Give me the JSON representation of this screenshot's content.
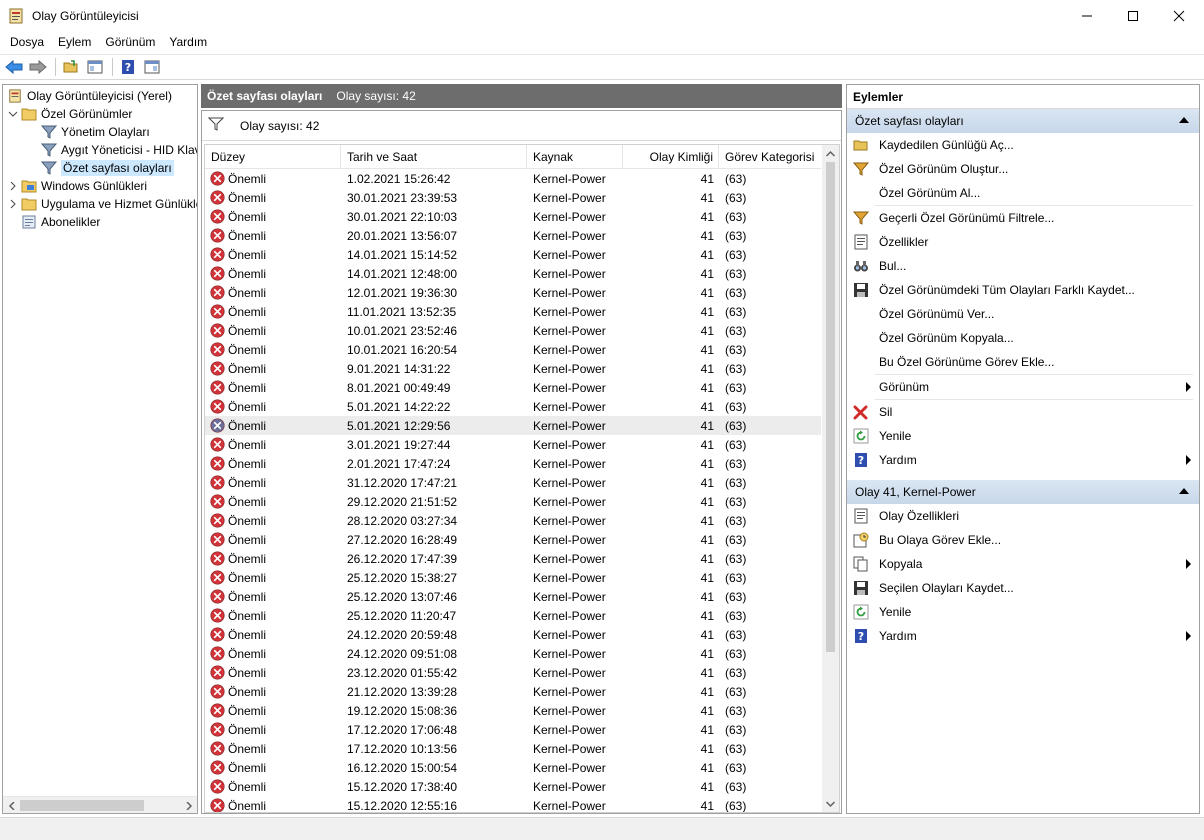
{
  "window": {
    "title": "Olay Görüntüleyicisi",
    "icon": "event-viewer-icon"
  },
  "menu": [
    "Dosya",
    "Eylem",
    "Görünüm",
    "Yardım"
  ],
  "toolbar": {
    "buttons": [
      "back-icon",
      "forward-icon",
      "open-folder-icon",
      "console-tree-icon",
      "help-icon",
      "action-pane-icon"
    ]
  },
  "tree": {
    "items": [
      {
        "label": "Olay Görüntüleyicisi (Yerel)",
        "icon": "event-viewer-icon"
      },
      {
        "label": "Özel Görünümler",
        "icon": "folder-icon"
      },
      {
        "label": "Yönetim Olayları",
        "icon": "filter-icon"
      },
      {
        "label": "Aygıt Yöneticisi - HID Klavye Aygıtı",
        "icon": "filter-icon"
      },
      {
        "label": "Özet sayfası olayları",
        "icon": "filter-icon"
      },
      {
        "label": "Windows Günlükleri",
        "icon": "folder-icon"
      },
      {
        "label": "Uygulama ve Hizmet Günlükleri",
        "icon": "folder-icon"
      },
      {
        "label": "Abonelikler",
        "icon": "subscriptions-icon"
      }
    ]
  },
  "center": {
    "header_title": "Özet sayfası olayları",
    "header_count": "Olay sayısı: 42",
    "filter_label": "Olay sayısı: 42",
    "columns": [
      "Düzey",
      "Tarih ve Saat",
      "Kaynak",
      "Olay Kimliği",
      "Görev Kategorisi"
    ],
    "rows": [
      {
        "level": "Önemli",
        "date": "1.02.2021 15:26:42",
        "source": "Kernel-Power",
        "id": "41",
        "category": "(63)"
      },
      {
        "level": "Önemli",
        "date": "30.01.2021 23:39:53",
        "source": "Kernel-Power",
        "id": "41",
        "category": "(63)"
      },
      {
        "level": "Önemli",
        "date": "30.01.2021 22:10:03",
        "source": "Kernel-Power",
        "id": "41",
        "category": "(63)"
      },
      {
        "level": "Önemli",
        "date": "20.01.2021 13:56:07",
        "source": "Kernel-Power",
        "id": "41",
        "category": "(63)"
      },
      {
        "level": "Önemli",
        "date": "14.01.2021 15:14:52",
        "source": "Kernel-Power",
        "id": "41",
        "category": "(63)"
      },
      {
        "level": "Önemli",
        "date": "14.01.2021 12:48:00",
        "source": "Kernel-Power",
        "id": "41",
        "category": "(63)"
      },
      {
        "level": "Önemli",
        "date": "12.01.2021 19:36:30",
        "source": "Kernel-Power",
        "id": "41",
        "category": "(63)"
      },
      {
        "level": "Önemli",
        "date": "11.01.2021 13:52:35",
        "source": "Kernel-Power",
        "id": "41",
        "category": "(63)"
      },
      {
        "level": "Önemli",
        "date": "10.01.2021 23:52:46",
        "source": "Kernel-Power",
        "id": "41",
        "category": "(63)"
      },
      {
        "level": "Önemli",
        "date": "10.01.2021 16:20:54",
        "source": "Kernel-Power",
        "id": "41",
        "category": "(63)"
      },
      {
        "level": "Önemli",
        "date": "9.01.2021 14:31:22",
        "source": "Kernel-Power",
        "id": "41",
        "category": "(63)"
      },
      {
        "level": "Önemli",
        "date": "8.01.2021 00:49:49",
        "source": "Kernel-Power",
        "id": "41",
        "category": "(63)"
      },
      {
        "level": "Önemli",
        "date": "5.01.2021 14:22:22",
        "source": "Kernel-Power",
        "id": "41",
        "category": "(63)"
      },
      {
        "level": "Önemli",
        "date": "5.01.2021 12:29:56",
        "source": "Kernel-Power",
        "id": "41",
        "category": "(63)",
        "selected": true
      },
      {
        "level": "Önemli",
        "date": "3.01.2021 19:27:44",
        "source": "Kernel-Power",
        "id": "41",
        "category": "(63)"
      },
      {
        "level": "Önemli",
        "date": "2.01.2021 17:47:24",
        "source": "Kernel-Power",
        "id": "41",
        "category": "(63)"
      },
      {
        "level": "Önemli",
        "date": "31.12.2020 17:47:21",
        "source": "Kernel-Power",
        "id": "41",
        "category": "(63)"
      },
      {
        "level": "Önemli",
        "date": "29.12.2020 21:51:52",
        "source": "Kernel-Power",
        "id": "41",
        "category": "(63)"
      },
      {
        "level": "Önemli",
        "date": "28.12.2020 03:27:34",
        "source": "Kernel-Power",
        "id": "41",
        "category": "(63)"
      },
      {
        "level": "Önemli",
        "date": "27.12.2020 16:28:49",
        "source": "Kernel-Power",
        "id": "41",
        "category": "(63)"
      },
      {
        "level": "Önemli",
        "date": "26.12.2020 17:47:39",
        "source": "Kernel-Power",
        "id": "41",
        "category": "(63)"
      },
      {
        "level": "Önemli",
        "date": "25.12.2020 15:38:27",
        "source": "Kernel-Power",
        "id": "41",
        "category": "(63)"
      },
      {
        "level": "Önemli",
        "date": "25.12.2020 13:07:46",
        "source": "Kernel-Power",
        "id": "41",
        "category": "(63)"
      },
      {
        "level": "Önemli",
        "date": "25.12.2020 11:20:47",
        "source": "Kernel-Power",
        "id": "41",
        "category": "(63)"
      },
      {
        "level": "Önemli",
        "date": "24.12.2020 20:59:48",
        "source": "Kernel-Power",
        "id": "41",
        "category": "(63)"
      },
      {
        "level": "Önemli",
        "date": "24.12.2020 09:51:08",
        "source": "Kernel-Power",
        "id": "41",
        "category": "(63)"
      },
      {
        "level": "Önemli",
        "date": "23.12.2020 01:55:42",
        "source": "Kernel-Power",
        "id": "41",
        "category": "(63)"
      },
      {
        "level": "Önemli",
        "date": "21.12.2020 13:39:28",
        "source": "Kernel-Power",
        "id": "41",
        "category": "(63)"
      },
      {
        "level": "Önemli",
        "date": "19.12.2020 15:08:36",
        "source": "Kernel-Power",
        "id": "41",
        "category": "(63)"
      },
      {
        "level": "Önemli",
        "date": "17.12.2020 17:06:48",
        "source": "Kernel-Power",
        "id": "41",
        "category": "(63)"
      },
      {
        "level": "Önemli",
        "date": "17.12.2020 10:13:56",
        "source": "Kernel-Power",
        "id": "41",
        "category": "(63)"
      },
      {
        "level": "Önemli",
        "date": "16.12.2020 15:00:54",
        "source": "Kernel-Power",
        "id": "41",
        "category": "(63)"
      },
      {
        "level": "Önemli",
        "date": "15.12.2020 17:38:40",
        "source": "Kernel-Power",
        "id": "41",
        "category": "(63)"
      },
      {
        "level": "Önemli",
        "date": "15.12.2020 12:55:16",
        "source": "Kernel-Power",
        "id": "41",
        "category": "(63)"
      }
    ]
  },
  "actions": {
    "title": "Eylemler",
    "sections": [
      {
        "title": "Özet sayfası olayları",
        "items": [
          {
            "label": "Kaydedilen Günlüğü Aç...",
            "icon": "open-folder-icon"
          },
          {
            "label": "Özel Görünüm Oluştur...",
            "icon": "filter-icon"
          },
          {
            "label": "Özel Görünüm Al...",
            "icon": ""
          },
          {
            "sep": true
          },
          {
            "label": "Geçerli Özel Görünümü Filtrele...",
            "icon": "filter-icon"
          },
          {
            "label": "Özellikler",
            "icon": "properties-icon"
          },
          {
            "label": "Bul...",
            "icon": "binoculars-icon"
          },
          {
            "label": "Özel Görünümdeki Tüm Olayları Farklı Kaydet...",
            "icon": "save-icon"
          },
          {
            "label": "Özel Görünümü Ver...",
            "icon": ""
          },
          {
            "label": "Özel Görünüm Kopyala...",
            "icon": ""
          },
          {
            "label": "Bu Özel Görünüme Görev Ekle...",
            "icon": ""
          },
          {
            "sep": true
          },
          {
            "label": "Görünüm",
            "icon": "",
            "submenu": true
          },
          {
            "sep": true
          },
          {
            "label": "Sil",
            "icon": "delete-icon"
          },
          {
            "label": "Yenile",
            "icon": "refresh-icon"
          },
          {
            "label": "Yardım",
            "icon": "help-icon",
            "submenu": true
          }
        ]
      },
      {
        "title": "Olay 41, Kernel-Power",
        "items": [
          {
            "label": "Olay Özellikleri",
            "icon": "properties-icon"
          },
          {
            "label": "Bu Olaya Görev Ekle...",
            "icon": "task-icon"
          },
          {
            "label": "Kopyala",
            "icon": "copy-icon",
            "submenu": true
          },
          {
            "label": "Seçilen Olayları Kaydet...",
            "icon": "save-icon"
          },
          {
            "label": "Yenile",
            "icon": "refresh-icon"
          },
          {
            "label": "Yardım",
            "icon": "help-icon",
            "submenu": true
          }
        ]
      }
    ]
  },
  "colors": {
    "selection": "#cce8ff",
    "header_bg": "#6d6d6d",
    "section_bg": "#d2dfee",
    "error_red": "#d13438"
  }
}
